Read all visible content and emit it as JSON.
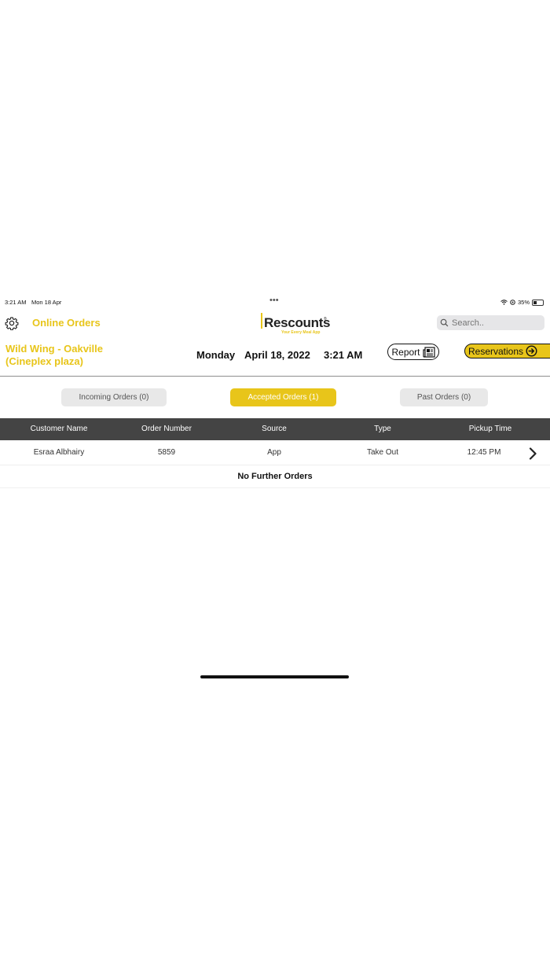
{
  "status_bar": {
    "time": "3:21 AM",
    "date": "Mon 18 Apr",
    "dots": "•••",
    "battery": "35%"
  },
  "header": {
    "title": "Online Orders",
    "logo_text": "Rescounts",
    "logo_mark": "®",
    "logo_tagline": "Your Every Meal App",
    "search_placeholder": "Search.."
  },
  "info": {
    "restaurant_line1": "Wild Wing - Oakville",
    "restaurant_line2": "(Cineplex plaza)",
    "day": "Monday",
    "date": "April 18, 2022",
    "time": "3:21 AM",
    "report_label": "Report",
    "reservations_label": "Reservations"
  },
  "tabs": [
    {
      "label": "Incoming Orders (0)",
      "active": false
    },
    {
      "label": "Accepted Orders (1)",
      "active": true
    },
    {
      "label": "Past Orders (0)",
      "active": false
    }
  ],
  "table": {
    "columns": [
      "Customer Name",
      "Order Number",
      "Source",
      "Type",
      "Pickup Time"
    ],
    "rows": [
      [
        "Esraa Albhairy",
        "5859",
        "App",
        "Take Out",
        "12:45 PM"
      ]
    ],
    "footer": "No Further Orders"
  },
  "colors": {
    "accent": "#e8c51a",
    "header_bg": "#444444"
  },
  "icons": [
    "gear-icon",
    "search-icon",
    "report-icon",
    "arrow-circle-right-icon",
    "chevron-right-icon",
    "wifi-icon",
    "battery-icon"
  ]
}
